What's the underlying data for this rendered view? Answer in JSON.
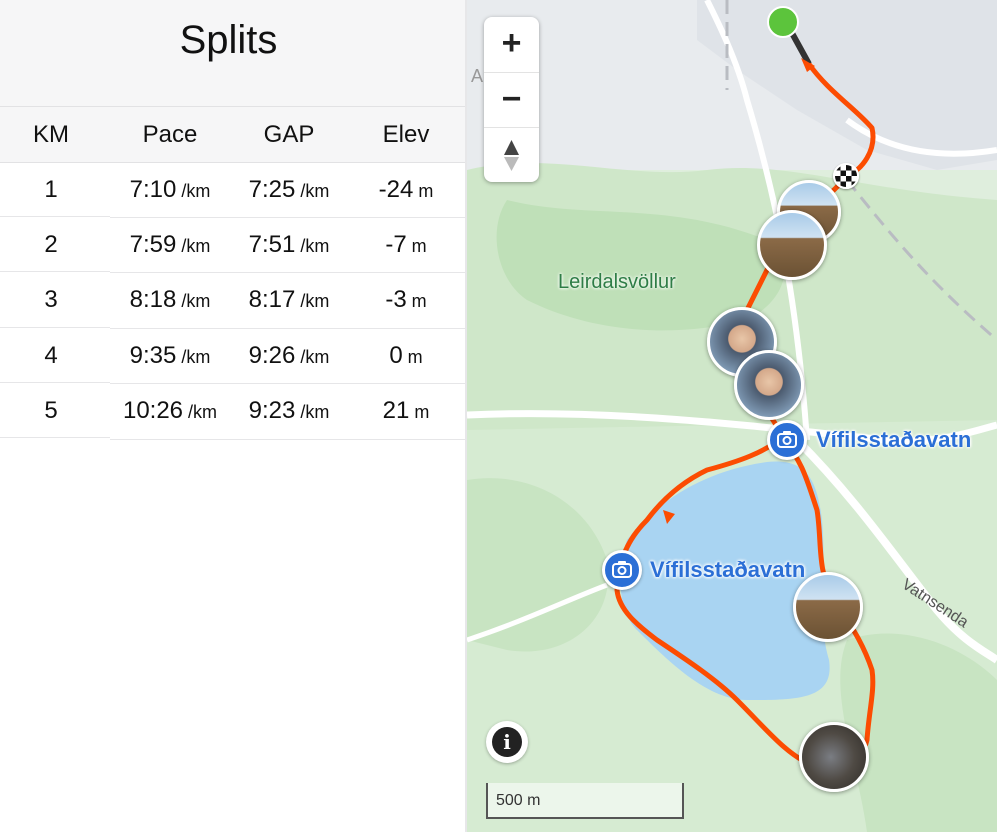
{
  "splits": {
    "title": "Splits",
    "columns": [
      "KM",
      "Pace",
      "GAP",
      "Elev"
    ],
    "rows": [
      {
        "km": "1",
        "pace": "7:10",
        "pace_unit": "/km",
        "gap": "7:25",
        "gap_unit": "/km",
        "elev": "-24",
        "elev_unit": "m"
      },
      {
        "km": "2",
        "pace": "7:59",
        "pace_unit": "/km",
        "gap": "7:51",
        "gap_unit": "/km",
        "elev": "-7",
        "elev_unit": "m"
      },
      {
        "km": "3",
        "pace": "8:18",
        "pace_unit": "/km",
        "gap": "8:17",
        "gap_unit": "/km",
        "elev": "-3",
        "elev_unit": "m"
      },
      {
        "km": "4",
        "pace": "9:35",
        "pace_unit": "/km",
        "gap": "9:26",
        "gap_unit": "/km",
        "elev": "0",
        "elev_unit": "m"
      },
      {
        "km": "5",
        "pace": "10:26",
        "pace_unit": "/km",
        "gap": "9:23",
        "gap_unit": "/km",
        "elev": "21",
        "elev_unit": "m"
      }
    ]
  },
  "map": {
    "controls": {
      "zoom_in": "+",
      "zoom_out": "−",
      "info": "i"
    },
    "scale_label": "500 m",
    "labels": {
      "golf_course": "Leirdalsvöllur",
      "lake_1": "Vífilsstaðavatn",
      "lake_2": "Vífilsstaðavatn",
      "road": "Vatnsenda",
      "area_partial": "AKSIT"
    },
    "colors": {
      "route": "#fc4c02",
      "water": "#a9d4f2",
      "park": "#c8e6c4",
      "start": "#5cc43c",
      "photo_pin": "#2b6fd6"
    },
    "icons": [
      "camera-icon",
      "compass-icon",
      "info-icon",
      "finish-flag-icon"
    ]
  }
}
